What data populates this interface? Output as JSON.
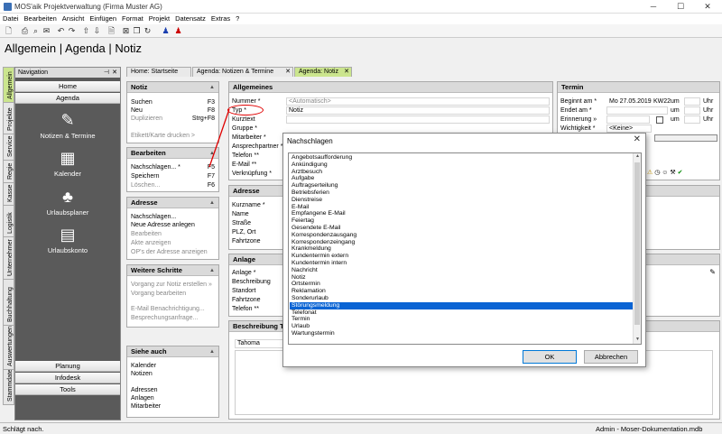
{
  "window": {
    "title": "MOS'aik Projektverwaltung (Firma Muster AG)"
  },
  "menu": [
    "Datei",
    "Bearbeiten",
    "Ansicht",
    "Einfügen",
    "Format",
    "Projekt",
    "Datensatz",
    "Extras",
    "?"
  ],
  "page_title": "Allgemein | Agenda | Notiz",
  "vertical_tabs": [
    "Allgemein",
    "Projekte",
    "Service",
    "Regie",
    "Kasse",
    "Logistik",
    "Unternehmer",
    "Buchhaltung",
    "Auswertungen",
    "Stammdaten"
  ],
  "navigation": {
    "header": "Navigation",
    "pin": "ᵽ",
    "buttons_top": [
      "Home",
      "Agenda"
    ],
    "items": [
      "Notizen & Termine",
      "Kalender",
      "Urlaubsplaner",
      "Urlaubskonto"
    ],
    "buttons_bottom": [
      "Planung",
      "Infodesk",
      "Tools"
    ]
  },
  "tabs": [
    {
      "label": "Home: Startseite"
    },
    {
      "label": "Agenda: Notizen & Termine"
    },
    {
      "label": "Agenda: Notiz"
    }
  ],
  "sidepanels": {
    "notiz": {
      "title": "Notiz",
      "rows": [
        {
          "label": "Suchen",
          "shortcut": "F3"
        },
        {
          "label": "Neu",
          "shortcut": "F8"
        },
        {
          "label": "Duplizieren",
          "shortcut": "Strg+F8"
        },
        {
          "label": "Etikett/Karte drucken >",
          "shortcut": ""
        }
      ]
    },
    "bearbeiten": {
      "title": "Bearbeiten",
      "rows": [
        {
          "label": "Nachschlagen... *",
          "shortcut": "F5"
        },
        {
          "label": "Speichern",
          "shortcut": "F7"
        },
        {
          "label": "Löschen...",
          "shortcut": "F6"
        }
      ]
    },
    "adresse": {
      "title": "Adresse",
      "rows": [
        "Nachschlagen...",
        "Neue Adresse anlegen",
        "Bearbeiten",
        "Akte anzeigen",
        "OP's der Adresse anzeigen"
      ]
    },
    "weitere": {
      "title": "Weitere Schritte",
      "rows": [
        "Vorgang zur Notiz erstellen »",
        "Vorgang bearbeiten",
        "E-Mail Benachrichtigung...",
        "Besprechungsanfrage..."
      ]
    },
    "siehe": {
      "title": "Siehe auch",
      "rows": [
        "Kalender",
        "Notizen",
        "Adressen",
        "Anlagen",
        "Mitarbeiter"
      ]
    }
  },
  "allgemeines": {
    "title": "Allgemeines",
    "labels": [
      "Nummer *",
      "Typ *",
      "Kurztext",
      "Gruppe *",
      "Mitarbeiter *",
      "Ansprechpartner *",
      "Telefon **",
      "E-Mail **",
      "Verknüpfung *"
    ],
    "nummer_value": "<Automatisch>",
    "typ_value": "Notiz"
  },
  "adresse_form": {
    "title": "Adresse",
    "labels": [
      "Kurzname *",
      "Name",
      "Straße",
      "PLZ, Ort",
      "Fahrtzone"
    ]
  },
  "anlage_form": {
    "title": "Anlage",
    "labels": [
      "Anlage *",
      "Beschreibung",
      "Standort",
      "Fahrtzone",
      "Telefon **"
    ]
  },
  "beschreibung": {
    "title": "Beschreibung Te",
    "font": "Tahoma"
  },
  "termin": {
    "title": "Termin",
    "beginnt_label": "Beginnt am *",
    "beginnt_value": "Mo 27.05.2019",
    "kw": "KW22",
    "um": "um",
    "uhr": "Uhr",
    "endet_label": "Endet am *",
    "erinnerung_label": "Erinnerung »",
    "wichtigkeit_label": "Wichtigkeit *",
    "wichtigkeit_value": "<Keine>"
  },
  "dialog": {
    "title": "Nachschlagen",
    "close": "✕",
    "items": [
      "Angebotsaufforderung",
      "Ankündigung",
      "Arztbesuch",
      "Aufgabe",
      "Auftragserteilung",
      "Betriebsferien",
      "Dienstreise",
      "E-Mail",
      "Empfangene E-Mail",
      "Feiertag",
      "Gesendete E-Mail",
      "Korrespondenzausgang",
      "Korrespondenzeingang",
      "Krankmeldung",
      "Kundentermin extern",
      "Kundentermin intern",
      "Nachricht",
      "Notiz",
      "Ortstermin",
      "Reklamation",
      "Sonderurlaub",
      "Störungsmeldung",
      "Telefonat",
      "Termin",
      "Urlaub",
      "Wartungstermin"
    ],
    "selected_index": 21,
    "ok": "OK",
    "cancel": "Abbrechen"
  },
  "status": {
    "left": "Schlägt nach.",
    "right": "Admin - Moser-Dokumentation.mdb"
  },
  "colors": {
    "accent_green": "#cbe58e",
    "selection_blue": "#0a64d4",
    "nav_gray": "#5a5a5a",
    "arrow_red": "#e00000"
  }
}
